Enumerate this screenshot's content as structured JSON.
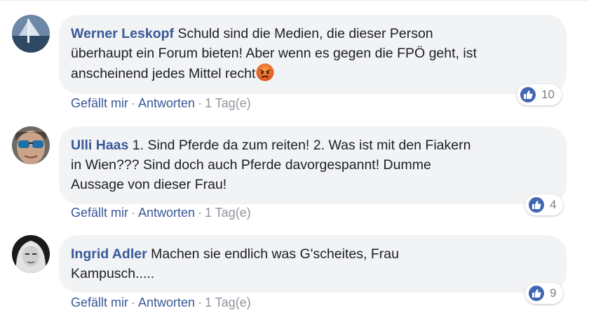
{
  "comments": [
    {
      "author": "Werner Leskopf",
      "line1": "Schuld sind die Medien, die dieser Person",
      "line2": "überhaupt ein Forum bieten! Aber wenn es gegen die FPÖ geht, ist",
      "line3": "anscheinend jedes Mittel recht",
      "emoji": "angry-face-emoji",
      "like_label": "Gefällt mir",
      "reply_label": "Antworten",
      "sep": "·",
      "time": "1 Tag(e)",
      "reaction_icon": "like-icon",
      "reaction_count": "10"
    },
    {
      "author": "Ulli Haas",
      "line1": "1. Sind Pferde da zum reiten! 2. Was ist mit den Fiakern",
      "line2": "in Wien??? Sind doch auch Pferde davorgespannt! Dumme",
      "line3": "Aussage von dieser Frau!",
      "like_label": "Gefällt mir",
      "reply_label": "Antworten",
      "sep": "·",
      "time": "1 Tag(e)",
      "reaction_icon": "like-icon",
      "reaction_count": "4"
    },
    {
      "author": "Ingrid Adler",
      "line1": "Machen sie endlich was G'scheites, Frau",
      "line2": "Kampusch.....",
      "like_label": "Gefällt mir",
      "reply_label": "Antworten",
      "sep": "·",
      "time": "1 Tag(e)",
      "reaction_icon": "like-icon",
      "reaction_count": "9"
    }
  ],
  "colors": {
    "link": "#385898",
    "meta": "#90949c",
    "bubble": "#f2f3f5",
    "like_badge": "#4267b2",
    "angry_emoji": "#e9710f"
  }
}
